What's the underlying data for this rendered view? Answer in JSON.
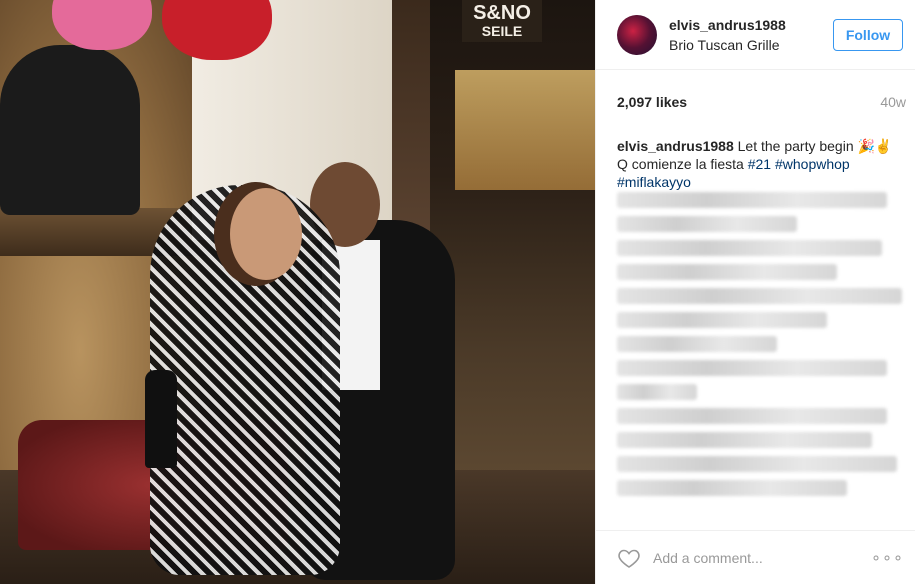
{
  "photo": {
    "sign_text_line1": "S&NO",
    "sign_text_line2": "SEILE"
  },
  "header": {
    "username": "elvis_andrus1988",
    "location": "Brio Tuscan Grille",
    "follow_label": "Follow"
  },
  "meta": {
    "likes": "2,097 likes",
    "age": "40w"
  },
  "caption": {
    "username": "elvis_andrus1988",
    "text": "Let the party begin 🎉✌️",
    "line2": "Q comienze la fiesta",
    "tag1": "#21",
    "tag2": "#whopwhop",
    "tag3": "#miflakayyo"
  },
  "footer": {
    "placeholder": "Add a comment...",
    "more": "∘∘∘"
  },
  "colors": {
    "accent": "#3897f0",
    "hashtag": "#003569"
  },
  "icons": {
    "heart": "heart-icon",
    "more": "more-options-icon"
  }
}
